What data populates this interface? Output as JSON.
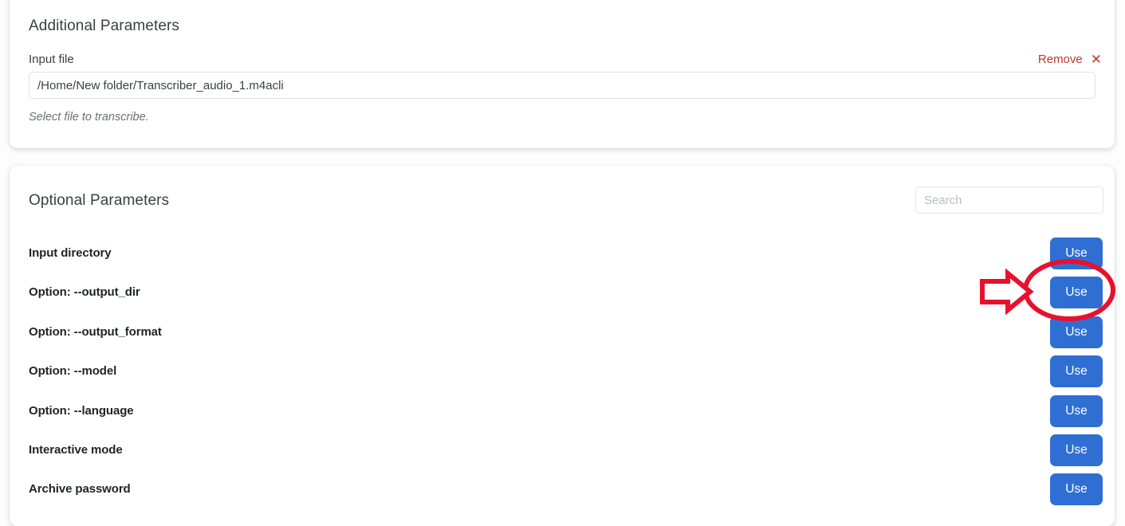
{
  "additional_card": {
    "title": "Additional Parameters",
    "field_label": "Input file",
    "input_value": "/Home/New folder/Transcriber_audio_1.m4acli",
    "input_placeholder": "",
    "help_text": "Select file to transcribe.",
    "remove_label": "Remove",
    "remove_icon_glyph": "✕"
  },
  "optional_card": {
    "title": "Optional Parameters",
    "search_placeholder": "Search",
    "search_value": "",
    "rows": [
      {
        "label": "Input directory",
        "action_label": "Use",
        "highlighted": false
      },
      {
        "label": "Option: --output_dir",
        "action_label": "Use",
        "highlighted": true
      },
      {
        "label": "Option: --output_format",
        "action_label": "Use",
        "highlighted": false
      },
      {
        "label": "Option: --model",
        "action_label": "Use",
        "highlighted": false
      },
      {
        "label": "Option: --language",
        "action_label": "Use",
        "highlighted": false
      },
      {
        "label": "Interactive mode",
        "action_label": "Use",
        "highlighted": false
      },
      {
        "label": "Archive password",
        "action_label": "Use",
        "highlighted": false
      }
    ]
  },
  "annotation": {
    "color": "#e8112d",
    "arrow_direction": "right",
    "target_row_label": "Option: --output_dir",
    "target_action_label": "Use"
  },
  "colors": {
    "accent_button": "#2f6fd4",
    "remove_link": "#c0392b",
    "annotation_red": "#e8112d",
    "card_background": "#ffffff",
    "page_background": "#fdfdfd",
    "row_label_text": "#1f2328",
    "title_text": "#3c4043"
  }
}
